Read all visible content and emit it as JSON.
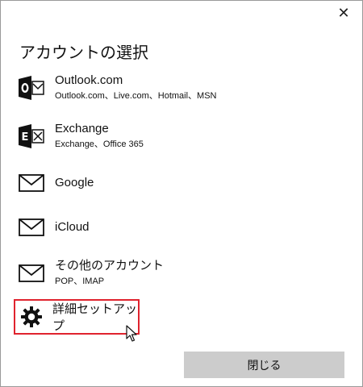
{
  "window": {
    "close_glyph": "✕",
    "title": "アカウントの選択"
  },
  "accounts": [
    {
      "label": "Outlook.com",
      "sub": "Outlook.com、Live.com、Hotmail、MSN",
      "icon": "outlook-icon"
    },
    {
      "label": "Exchange",
      "sub": "Exchange、Office 365",
      "icon": "exchange-icon"
    },
    {
      "label": "Google",
      "sub": "",
      "icon": "mail-icon"
    },
    {
      "label": "iCloud",
      "sub": "",
      "icon": "mail-icon"
    },
    {
      "label": "その他のアカウント",
      "sub": "POP、IMAP",
      "icon": "mail-icon"
    }
  ],
  "advanced_setup": {
    "label": "詳細セットアップ",
    "icon": "gear-icon",
    "highlight_color": "#e0232e"
  },
  "footer": {
    "close_button_label": "閉じる"
  },
  "colors": {
    "button_bg": "#cccccc",
    "window_border": "#9a9a9a"
  }
}
